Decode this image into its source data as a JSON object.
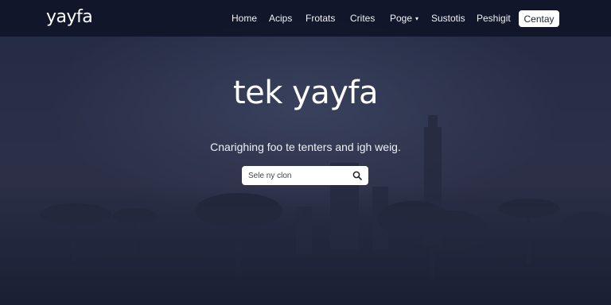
{
  "brand": {
    "logo_text": "yayfa"
  },
  "nav": {
    "items": [
      {
        "label": "Home",
        "caret": false
      },
      {
        "label": "Acips",
        "caret": false
      },
      {
        "label": "Frotats",
        "caret": false
      },
      {
        "label": "Crites",
        "caret": false
      },
      {
        "label": "Poge",
        "caret": true
      },
      {
        "label": "Sustotis",
        "caret": false
      },
      {
        "label": "Peshigit",
        "caret": false
      }
    ],
    "cta_label": "Centay"
  },
  "hero": {
    "title": "tek yayfa",
    "subtitle": "Cnarighing foo te tenters and igh weig.",
    "search_placeholder": "Sele ny clon"
  },
  "colors": {
    "navbar": "#101528",
    "background": "#2a2f48",
    "cta_bg": "#ffffff",
    "cta_text": "#1d2236"
  },
  "icons": {
    "search": "magnifier-icon",
    "dropdown": "caret-down-icon"
  }
}
